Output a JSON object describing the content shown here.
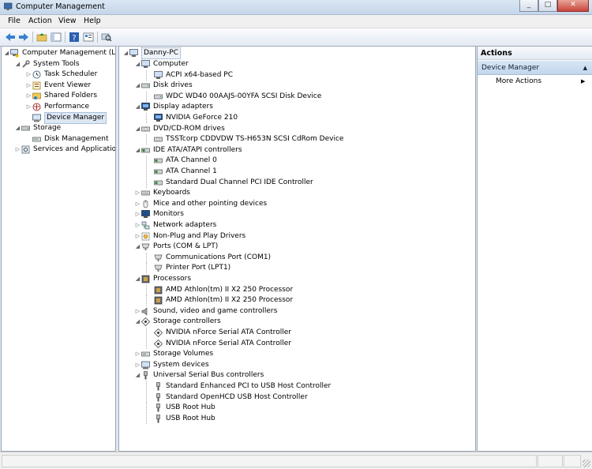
{
  "window": {
    "title": "Computer Management",
    "buttons": {
      "minimize": "_",
      "maximize": "□",
      "close": "✕"
    }
  },
  "menu": [
    "File",
    "Action",
    "View",
    "Help"
  ],
  "toolbar": {
    "icons": [
      "back-arrow-icon",
      "forward-arrow-icon",
      "up-folder-icon",
      "show-hide-console-tree-icon",
      "help-icon",
      "properties-icon",
      "scan-hardware-icon"
    ]
  },
  "left_tree": {
    "items": [
      {
        "label": "Computer Management (Local",
        "icon": "computer-management-icon",
        "level": 0,
        "expander": "◢"
      },
      {
        "label": "System Tools",
        "icon": "tools-icon",
        "level": 1,
        "expander": "◢"
      },
      {
        "label": "Task Scheduler",
        "icon": "clock-icon",
        "level": 2,
        "expander": "▷"
      },
      {
        "label": "Event Viewer",
        "icon": "event-viewer-icon",
        "level": 2,
        "expander": "▷"
      },
      {
        "label": "Shared Folders",
        "icon": "shared-folder-icon",
        "level": 2,
        "expander": "▷"
      },
      {
        "label": "Performance",
        "icon": "performance-icon",
        "level": 2,
        "expander": "▷"
      },
      {
        "label": "Device Manager",
        "icon": "device-manager-icon",
        "level": 2,
        "expander": "",
        "selected": true
      },
      {
        "label": "Storage",
        "icon": "storage-icon",
        "level": 1,
        "expander": "◢"
      },
      {
        "label": "Disk Management",
        "icon": "disk-icon",
        "level": 2,
        "expander": ""
      },
      {
        "label": "Services and Applications",
        "icon": "services-icon",
        "level": 1,
        "expander": "▷"
      }
    ]
  },
  "device_tree": {
    "root": "Danny-PC",
    "items": [
      {
        "label": "Computer",
        "icon": "computer-icon",
        "level": 1,
        "expander": "◢"
      },
      {
        "label": "ACPI x64-based PC",
        "icon": "computer-icon",
        "level": 2
      },
      {
        "label": "Disk drives",
        "icon": "disk-drive-icon",
        "level": 1,
        "expander": "◢"
      },
      {
        "label": "WDC WD40 00AAJS-00YFA SCSI Disk Device",
        "icon": "disk-drive-icon",
        "level": 2
      },
      {
        "label": "Display adapters",
        "icon": "display-adapter-icon",
        "level": 1,
        "expander": "◢"
      },
      {
        "label": "NVIDIA GeForce 210",
        "icon": "display-adapter-icon",
        "level": 2
      },
      {
        "label": "DVD/CD-ROM drives",
        "icon": "dvd-drive-icon",
        "level": 1,
        "expander": "◢"
      },
      {
        "label": "TSSTcorp CDDVDW TS-H653N SCSI CdRom Device",
        "icon": "dvd-drive-icon",
        "level": 2
      },
      {
        "label": "IDE ATA/ATAPI controllers",
        "icon": "ide-controller-icon",
        "level": 1,
        "expander": "◢"
      },
      {
        "label": "ATA Channel 0",
        "icon": "ide-controller-icon",
        "level": 2
      },
      {
        "label": "ATA Channel 1",
        "icon": "ide-controller-icon",
        "level": 2
      },
      {
        "label": "Standard Dual Channel PCI IDE Controller",
        "icon": "ide-controller-icon",
        "level": 2
      },
      {
        "label": "Keyboards",
        "icon": "keyboard-icon",
        "level": 1,
        "expander": "▷"
      },
      {
        "label": "Mice and other pointing devices",
        "icon": "mouse-icon",
        "level": 1,
        "expander": "▷"
      },
      {
        "label": "Monitors",
        "icon": "monitor-icon",
        "level": 1,
        "expander": "▷"
      },
      {
        "label": "Network adapters",
        "icon": "network-adapter-icon",
        "level": 1,
        "expander": "▷"
      },
      {
        "label": "Non-Plug and Play Drivers",
        "icon": "driver-icon",
        "level": 1,
        "expander": "▷"
      },
      {
        "label": "Ports (COM & LPT)",
        "icon": "port-icon",
        "level": 1,
        "expander": "◢"
      },
      {
        "label": "Communications Port (COM1)",
        "icon": "port-icon",
        "level": 2
      },
      {
        "label": "Printer Port (LPT1)",
        "icon": "port-icon",
        "level": 2
      },
      {
        "label": "Processors",
        "icon": "processor-icon",
        "level": 1,
        "expander": "◢"
      },
      {
        "label": "AMD Athlon(tm) II X2 250 Processor",
        "icon": "processor-icon",
        "level": 2
      },
      {
        "label": "AMD Athlon(tm) II X2 250 Processor",
        "icon": "processor-icon",
        "level": 2
      },
      {
        "label": "Sound, video and game controllers",
        "icon": "speaker-icon",
        "level": 1,
        "expander": "▷"
      },
      {
        "label": "Storage controllers",
        "icon": "storage-controller-icon",
        "level": 1,
        "expander": "◢"
      },
      {
        "label": "NVIDIA nForce Serial ATA Controller",
        "icon": "storage-controller-icon",
        "level": 2
      },
      {
        "label": "NVIDIA nForce Serial ATA Controller",
        "icon": "storage-controller-icon",
        "level": 2
      },
      {
        "label": "Storage Volumes",
        "icon": "storage-volume-icon",
        "level": 1,
        "expander": "▷"
      },
      {
        "label": "System devices",
        "icon": "system-device-icon",
        "level": 1,
        "expander": "▷"
      },
      {
        "label": "Universal Serial Bus controllers",
        "icon": "usb-icon",
        "level": 1,
        "expander": "◢"
      },
      {
        "label": "Standard Enhanced PCI to USB Host Controller",
        "icon": "usb-icon",
        "level": 2
      },
      {
        "label": "Standard OpenHCD USB Host Controller",
        "icon": "usb-icon",
        "level": 2
      },
      {
        "label": "USB Root Hub",
        "icon": "usb-icon",
        "level": 2
      },
      {
        "label": "USB Root Hub",
        "icon": "usb-icon",
        "level": 2
      }
    ]
  },
  "actions": {
    "header": "Actions",
    "section": "Device Manager",
    "section_caret": "▲",
    "items": [
      {
        "label": "More Actions",
        "arrow": "▶"
      }
    ]
  },
  "colors": {
    "selection": "#dde7f3",
    "accent": "#c3d6ec"
  }
}
